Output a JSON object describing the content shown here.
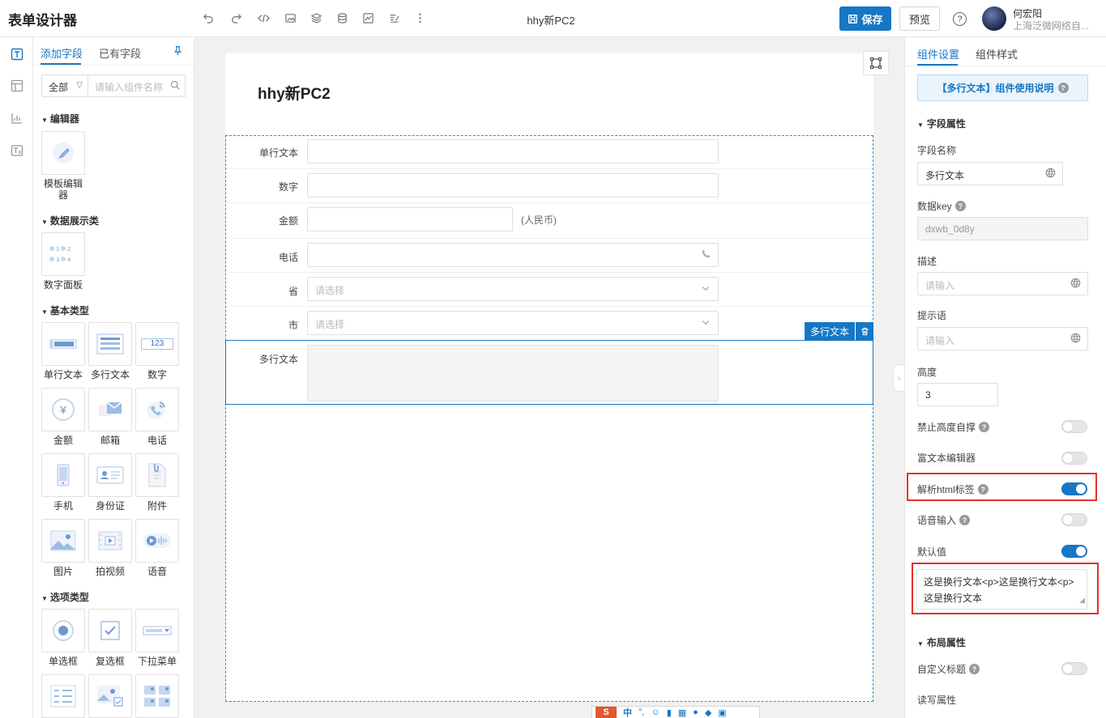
{
  "header": {
    "app_title": "表单设计器",
    "doc_name": "hhy新PC2",
    "save_label": "保存",
    "preview_label": "预览",
    "help_glyph": "?",
    "user_name": "何宏阳",
    "user_org": "上海泛微网络自..."
  },
  "palette": {
    "tab_add": "添加字段",
    "tab_existing": "已有字段",
    "filter_value": "全部",
    "search_placeholder": "请输入组件名称",
    "sections": {
      "editor": "编辑器",
      "display": "数据展示类",
      "basic": "基本类型",
      "options": "选项类型"
    },
    "items": {
      "template_editor": "模板编辑器",
      "number_panel": "数字面板",
      "single_line": "单行文本",
      "multi_line": "多行文本",
      "number": "数字",
      "amount": "金额",
      "email": "邮箱",
      "phone": "电话",
      "mobile": "手机",
      "id_card": "身份证",
      "attachment": "附件",
      "image": "图片",
      "video": "拍视频",
      "voice": "语音",
      "radio": "单选框",
      "checkbox": "复选框",
      "dropdown": "下拉菜单"
    },
    "number_icon_text": "123",
    "amount_icon_text": "¥"
  },
  "form": {
    "title": "hhy新PC2",
    "fields": [
      {
        "label": "单行文本",
        "placeholder": ""
      },
      {
        "label": "数字",
        "placeholder": ""
      },
      {
        "label": "金额",
        "placeholder": "",
        "suffix": "(人民币)"
      },
      {
        "label": "电话",
        "placeholder": ""
      },
      {
        "label": "省",
        "placeholder": "请选择"
      },
      {
        "label": "市",
        "placeholder": "请选择"
      },
      {
        "label": "多行文本",
        "placeholder": ""
      }
    ],
    "selected_chip": "多行文本"
  },
  "ime": {
    "logo": "S",
    "mode": "中"
  },
  "settings": {
    "tab_component": "组件设置",
    "tab_style": "组件样式",
    "usage_note": "【多行文本】组件使用说明",
    "section_field": "字段属性",
    "field_name_label": "字段名称",
    "field_name_value": "多行文本",
    "data_key_label": "数据key",
    "data_key_value": "dxwb_0d8y",
    "desc_label": "描述",
    "desc_placeholder": "请输入",
    "hint_label": "提示语",
    "hint_placeholder": "请输入",
    "height_label": "高度",
    "height_value": "3",
    "no_autosize_label": "禁止高度自撑",
    "rich_text_label": "富文本编辑器",
    "parse_html_label": "解析html标签",
    "voice_input_label": "语音输入",
    "default_label": "默认值",
    "default_line1": "这是换行文本<p>这是换行文本<p>",
    "default_line2": "这是换行文本",
    "section_layout": "布局属性",
    "custom_title_label": "自定义标题",
    "rw_label": "读写属性",
    "toggles": {
      "no_autosize": false,
      "rich_text": false,
      "parse_html": true,
      "voice_input": false,
      "default": true,
      "custom_title": false
    }
  },
  "colors": {
    "accent": "#1677c6",
    "highlight": "#e2312d"
  }
}
